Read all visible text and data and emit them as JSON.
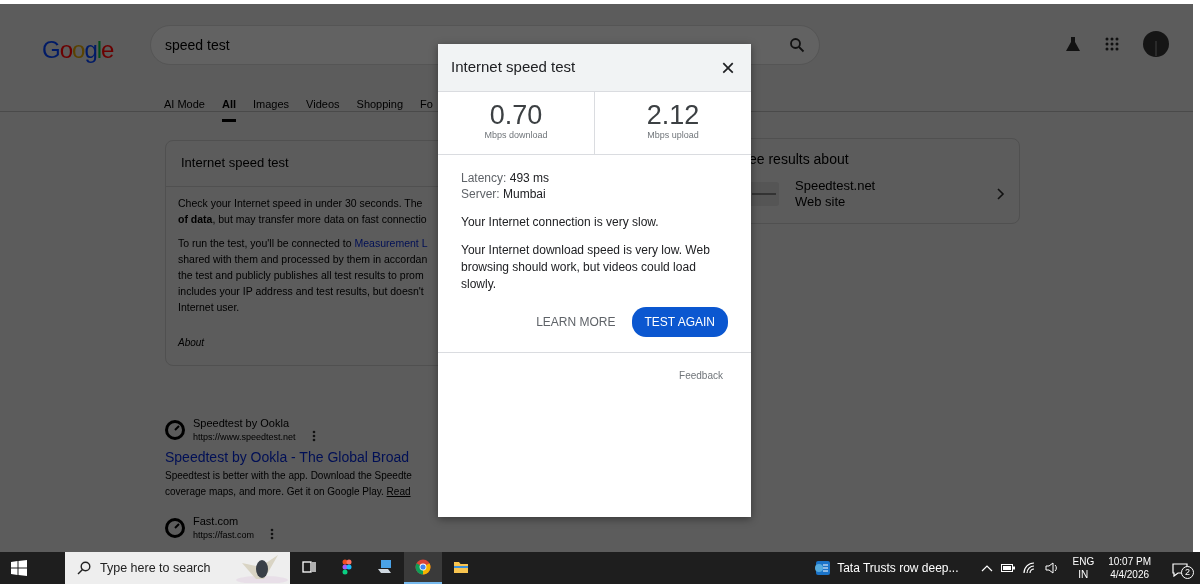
{
  "page": {
    "logo": "Google",
    "search_query": "speed test",
    "tabs": [
      {
        "label": "AI Mode",
        "selected": false
      },
      {
        "label": "All",
        "selected": true
      },
      {
        "label": "Images",
        "selected": false
      },
      {
        "label": "Videos",
        "selected": false
      },
      {
        "label": "Shopping",
        "selected": false
      },
      {
        "label": "Fo",
        "selected": false
      }
    ],
    "speed_card": {
      "title": "Internet speed test",
      "paragraph_1": [
        "Check your Internet speed in under 30 seconds. The",
        "**of data**, but may transfer more data on fast connectio"
      ],
      "paragraph_2_start": "To run the test, you'll be connected to",
      "paragraph_2_link": "Measurement L",
      "paragraph_2": [
        "shared with them and processed by them in accordan",
        "the test and publicly publishes all test results to prom",
        "includes your IP address and test results, but doesn't",
        "Internet user."
      ],
      "about": "About"
    },
    "see_results": {
      "title": "ee results about",
      "items": [
        {
          "name": "Speedtest.net",
          "type": "Web site"
        }
      ]
    },
    "results": [
      {
        "site": "Speedtest by Ookla",
        "url": "https://www.speedtest.net",
        "title": "Speedtest by Ookla - The Global Broad",
        "snippet": [
          "Speedtest is better with the app. Download the Speedte",
          "coverage maps, and more. Get it on Google Play."
        ],
        "more": "Read"
      },
      {
        "site": "Fast.com",
        "url": "https://fast.com"
      }
    ]
  },
  "dialog": {
    "title": "Internet speed test",
    "close": "×",
    "metrics": [
      {
        "value": "0.70",
        "label": "Mbps download"
      },
      {
        "value": "2.12",
        "label": "Mbps upload"
      }
    ],
    "details": [
      {
        "label": "Latency:",
        "value": "493 ms"
      },
      {
        "label": "Server:",
        "value": "Mumbai"
      }
    ],
    "status": "Your Internet connection is very slow.",
    "explanation": "Your Internet download speed is very low. Web browsing should work, but videos could load slowly.",
    "buttons": [
      {
        "label": "LEARN MORE",
        "kind": "text"
      },
      {
        "label": "TEST AGAIN",
        "kind": "filled"
      }
    ],
    "feedback": "Feedback"
  },
  "taskbar": {
    "search_placeholder": "Type here to search",
    "apps": [
      {
        "kind": "taskview",
        "selected": false
      },
      {
        "kind": "figma",
        "selected": false
      },
      {
        "kind": "pc",
        "selected": false
      },
      {
        "kind": "chrome",
        "selected": true
      },
      {
        "kind": "folder",
        "selected": false
      }
    ],
    "news": "Tata Trusts row deep...",
    "language": "ENG",
    "region": "IN",
    "time": "10:07 PM",
    "date": "4/4/2026",
    "notifications": "2"
  }
}
